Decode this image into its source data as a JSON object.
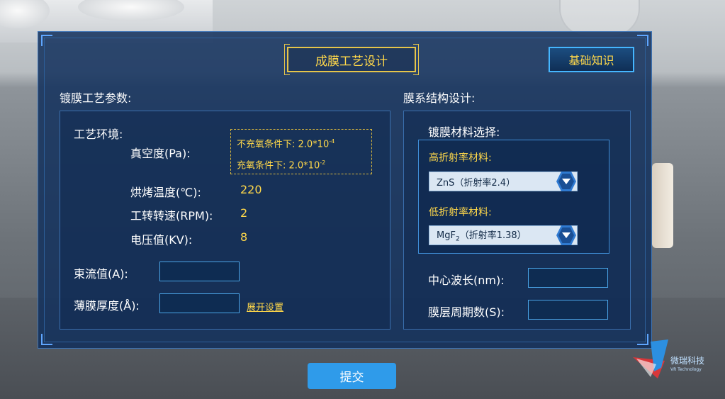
{
  "title": "成膜工艺设计",
  "knowledge_button": "基础知识",
  "left": {
    "header": "镀膜工艺参数:",
    "env_label": "工艺环境:",
    "vacuum_label": "真空度(Pa):",
    "vacuum_hint": {
      "line1_prefix": "不充氧条件下: 2.0*10",
      "line1_exp": "-4",
      "line2_prefix": "充氧条件下: 2.0*10",
      "line2_exp": "-2"
    },
    "bake_label": "烘烤温度(℃):",
    "bake_value": "220",
    "speed_label": "工转转速(RPM):",
    "speed_value": "2",
    "voltage_label": "电压值(KV):",
    "voltage_value": "8",
    "beam_label": "束流值(A):",
    "thickness_label": "薄膜厚度(Å):",
    "expand_link": "展开设置"
  },
  "right": {
    "header": "膜系结构设计:",
    "material_label": "镀膜材料选择:",
    "high_label": "高折射率材料:",
    "high_value": "ZnS（折射率2.4）",
    "low_label": "低折射率材料:",
    "low_value_prefix": "MgF",
    "low_value_sub": "2",
    "low_value_suffix": "（折射率1.38）",
    "wavelength_label": "中心波长(nm):",
    "period_label": "膜层周期数(S):"
  },
  "submit_label": "提交",
  "logo": {
    "name": "微瑞科技",
    "sub": "VR Technology"
  },
  "colors": {
    "accent_yellow": "#ffd84a",
    "panel_bg": "#12305c",
    "submit": "#2f9bea"
  }
}
